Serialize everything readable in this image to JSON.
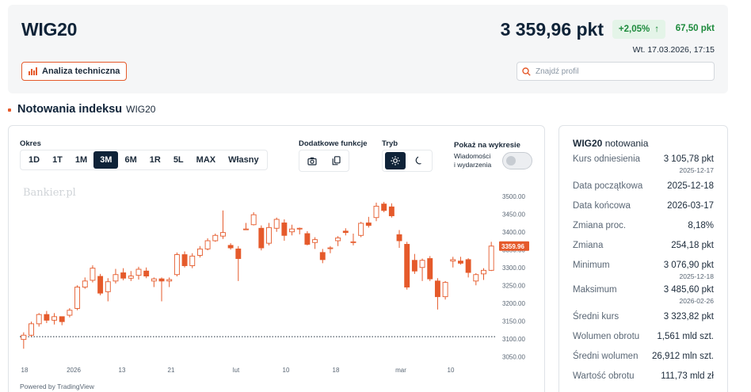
{
  "header": {
    "title": "WIG20",
    "price": "3 359,96 pkt",
    "change_pct": "+2,05%",
    "change_abs": "67,50 pkt",
    "datetime": "Wt. 17.03.2026, 17:15",
    "analysis_button": "Analiza techniczna",
    "search_placeholder": "Znajdź profil"
  },
  "section": {
    "title": "Notowania indeksu",
    "subtitle": "WIG20"
  },
  "controls": {
    "period_label": "Okres",
    "periods": [
      "1D",
      "1T",
      "1M",
      "3M",
      "6M",
      "1R",
      "5L",
      "MAX",
      "Własny"
    ],
    "active_period": "3M",
    "extra_label": "Dodatkowe funkcje",
    "mode_label": "Tryb",
    "show_label": "Pokaż na wykresie",
    "show_option_line1": "Wiadomości",
    "show_option_line2": "i wydarzenia",
    "show_toggle": false
  },
  "watermark": "Bankier.pl",
  "powered_by": "Powered by TradingView",
  "chart_data": {
    "type": "candlestick",
    "y_ticks": [
      3500,
      3450,
      3400,
      3350,
      3300,
      3250,
      3200,
      3150,
      3100,
      3050
    ],
    "y_tick_labels": [
      "3500.00",
      "3450.00",
      "3400.00",
      "3350.00",
      "3300.00",
      "3250.00",
      "3200.00",
      "3150.00",
      "3100.00",
      "3050.00"
    ],
    "ylim": [
      3035,
      3515
    ],
    "x_tick_labels": [
      "18",
      "2026",
      "13",
      "21",
      "lut",
      "10",
      "18",
      "mar",
      "10"
    ],
    "last_price_label": "3359.96",
    "reference_level": 3105.78,
    "up_color": "#ffffff",
    "down_color": "#e55a2b",
    "candles": [
      {
        "o": 3098,
        "h": 3118,
        "l": 3072,
        "c": 3110
      },
      {
        "o": 3110,
        "h": 3148,
        "l": 3106,
        "c": 3142
      },
      {
        "o": 3142,
        "h": 3172,
        "l": 3134,
        "c": 3168
      },
      {
        "o": 3168,
        "h": 3178,
        "l": 3144,
        "c": 3152
      },
      {
        "o": 3152,
        "h": 3172,
        "l": 3140,
        "c": 3162
      },
      {
        "o": 3162,
        "h": 3158,
        "l": 3138,
        "c": 3148
      },
      {
        "o": 3166,
        "h": 3186,
        "l": 3160,
        "c": 3180
      },
      {
        "o": 3185,
        "h": 3250,
        "l": 3180,
        "c": 3245
      },
      {
        "o": 3245,
        "h": 3272,
        "l": 3240,
        "c": 3262
      },
      {
        "o": 3264,
        "h": 3306,
        "l": 3258,
        "c": 3298
      },
      {
        "o": 3275,
        "h": 3282,
        "l": 3222,
        "c": 3228
      },
      {
        "o": 3232,
        "h": 3270,
        "l": 3205,
        "c": 3260
      },
      {
        "o": 3262,
        "h": 3296,
        "l": 3255,
        "c": 3280
      },
      {
        "o": 3285,
        "h": 3298,
        "l": 3264,
        "c": 3270
      },
      {
        "o": 3270,
        "h": 3290,
        "l": 3262,
        "c": 3276
      },
      {
        "o": 3278,
        "h": 3302,
        "l": 3266,
        "c": 3295
      },
      {
        "o": 3290,
        "h": 3300,
        "l": 3270,
        "c": 3276
      },
      {
        "o": 3262,
        "h": 3272,
        "l": 3245,
        "c": 3268
      },
      {
        "o": 3268,
        "h": 3272,
        "l": 3205,
        "c": 3262
      },
      {
        "o": 3262,
        "h": 3272,
        "l": 3245,
        "c": 3266
      },
      {
        "o": 3280,
        "h": 3342,
        "l": 3275,
        "c": 3336
      },
      {
        "o": 3336,
        "h": 3345,
        "l": 3300,
        "c": 3305
      },
      {
        "o": 3305,
        "h": 3340,
        "l": 3298,
        "c": 3332
      },
      {
        "o": 3334,
        "h": 3360,
        "l": 3328,
        "c": 3352
      },
      {
        "o": 3352,
        "h": 3382,
        "l": 3348,
        "c": 3375
      },
      {
        "o": 3375,
        "h": 3395,
        "l": 3372,
        "c": 3390
      },
      {
        "o": 3388,
        "h": 3460,
        "l": 3380,
        "c": 3398
      },
      {
        "o": 3362,
        "h": 3368,
        "l": 3350,
        "c": 3355
      },
      {
        "o": 3352,
        "h": 3360,
        "l": 3262,
        "c": 3325
      },
      {
        "o": 3408,
        "h": 3425,
        "l": 3405,
        "c": 3408
      },
      {
        "o": 3420,
        "h": 3455,
        "l": 3418,
        "c": 3448
      },
      {
        "o": 3410,
        "h": 3418,
        "l": 3348,
        "c": 3355
      },
      {
        "o": 3368,
        "h": 3425,
        "l": 3362,
        "c": 3412
      },
      {
        "o": 3410,
        "h": 3440,
        "l": 3400,
        "c": 3435
      },
      {
        "o": 3425,
        "h": 3435,
        "l": 3375,
        "c": 3390
      },
      {
        "o": 3400,
        "h": 3420,
        "l": 3390,
        "c": 3408
      },
      {
        "o": 3410,
        "h": 3412,
        "l": 3393,
        "c": 3410
      },
      {
        "o": 3395,
        "h": 3402,
        "l": 3362,
        "c": 3365
      },
      {
        "o": 3370,
        "h": 3385,
        "l": 3352,
        "c": 3378
      },
      {
        "o": 3342,
        "h": 3352,
        "l": 3312,
        "c": 3322
      },
      {
        "o": 3354,
        "h": 3360,
        "l": 3340,
        "c": 3355
      },
      {
        "o": 3375,
        "h": 3388,
        "l": 3360,
        "c": 3383
      },
      {
        "o": 3402,
        "h": 3410,
        "l": 3390,
        "c": 3398
      },
      {
        "o": 3370,
        "h": 3395,
        "l": 3362,
        "c": 3372
      },
      {
        "o": 3390,
        "h": 3428,
        "l": 3385,
        "c": 3424
      },
      {
        "o": 3425,
        "h": 3442,
        "l": 3412,
        "c": 3418
      },
      {
        "o": 3440,
        "h": 3482,
        "l": 3430,
        "c": 3472
      },
      {
        "o": 3478,
        "h": 3484,
        "l": 3455,
        "c": 3460
      },
      {
        "o": 3470,
        "h": 3480,
        "l": 3440,
        "c": 3445
      },
      {
        "o": 3392,
        "h": 3405,
        "l": 3355,
        "c": 3375
      },
      {
        "o": 3365,
        "h": 3372,
        "l": 3238,
        "c": 3245
      },
      {
        "o": 3320,
        "h": 3338,
        "l": 3282,
        "c": 3290
      },
      {
        "o": 3300,
        "h": 3325,
        "l": 3262,
        "c": 3320
      },
      {
        "o": 3325,
        "h": 3332,
        "l": 3262,
        "c": 3268
      },
      {
        "o": 3262,
        "h": 3270,
        "l": 3182,
        "c": 3218
      },
      {
        "o": 3218,
        "h": 3262,
        "l": 3210,
        "c": 3258
      },
      {
        "o": 3318,
        "h": 3330,
        "l": 3300,
        "c": 3322
      },
      {
        "o": 3318,
        "h": 3330,
        "l": 3308,
        "c": 3312
      },
      {
        "o": 3322,
        "h": 3326,
        "l": 3272,
        "c": 3286
      },
      {
        "o": 3262,
        "h": 3284,
        "l": 3250,
        "c": 3280
      },
      {
        "o": 3282,
        "h": 3298,
        "l": 3265,
        "c": 3292
      },
      {
        "o": 3292,
        "h": 3372,
        "l": 3290,
        "c": 3360
      }
    ]
  },
  "stats": {
    "title_bold": "WIG20",
    "title_rest": "notowania",
    "rows": [
      {
        "label": "Kurs odniesienia",
        "value": "3 105,78 pkt",
        "sub": "2025-12-17"
      },
      {
        "label": "Data początkowa",
        "value": "2025-12-18",
        "sub": ""
      },
      {
        "label": "Data końcowa",
        "value": "2026-03-17",
        "sub": ""
      },
      {
        "label": "Zmiana proc.",
        "value": "8,18%",
        "sub": ""
      },
      {
        "label": "Zmiana",
        "value": "254,18 pkt",
        "sub": ""
      },
      {
        "label": "Minimum",
        "value": "3 076,90 pkt",
        "sub": "2025-12-18"
      },
      {
        "label": "Maksimum",
        "value": "3 485,60 pkt",
        "sub": "2026-02-26"
      },
      {
        "label": "Średni kurs",
        "value": "3 323,82 pkt",
        "sub": ""
      },
      {
        "label": "Wolumen obrotu",
        "value": "1,561 mld szt.",
        "sub": ""
      },
      {
        "label": "Średni wolumen",
        "value": "26,912 mln szt.",
        "sub": ""
      },
      {
        "label": "Wartość obrotu",
        "value": "111,73 mld zł",
        "sub": ""
      }
    ]
  }
}
